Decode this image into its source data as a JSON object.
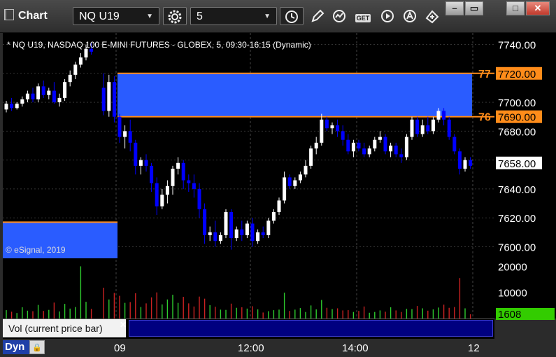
{
  "window": {
    "title": "Chart",
    "symbol": "NQ U19",
    "interval": "5",
    "controls": {
      "minimize": "–",
      "restore": "▭",
      "maximize": "□",
      "close": "✕"
    },
    "toolbar_icons": [
      "interval-clock-icon",
      "pencil-icon",
      "cursor-icon",
      "get-icon",
      "play-icon",
      "autoscale-icon",
      "link-icon"
    ]
  },
  "chart": {
    "header": "* NQ U19, NASDAQ 100 E-MINI FUTURES - GLOBEX, 5, 09:30-16:15 (Dynamic)",
    "copyright": "© eSignal, 2019",
    "price_ticks": [
      "7740.00",
      "7700.00",
      "7680.00",
      "7640.00",
      "7620.00",
      "7600.00"
    ],
    "levels": [
      {
        "short": "77",
        "price": "7720.00"
      },
      {
        "short": "76",
        "price": "7690.00"
      }
    ],
    "last_price": "7658.00",
    "vol_ticks": [
      "20000",
      "10000"
    ],
    "last_volume": "1608",
    "volume_study_label": "Vol (current price bar)",
    "time_ticks": [
      "09",
      "12:00",
      "14:00",
      "12"
    ],
    "bottom_buttons": {
      "dyn": "Dyn"
    },
    "colors": {
      "up": "#ffffff",
      "down": "#0000ff",
      "zone": "#2a5cff",
      "level_line": "#ff8c1a",
      "vol_up": "#2ecc2e",
      "vol_down": "#cc2222",
      "last_volume_bg": "#33cc00"
    }
  },
  "chart_data": {
    "type": "candlestick",
    "session_breaks": [
      "09:30"
    ],
    "price_ylim": [
      7592,
      7748
    ],
    "volume_ylim": [
      0,
      22000
    ],
    "candles": [
      {
        "o": 7695,
        "h": 7701,
        "c": 7699,
        "l": 7693
      },
      {
        "o": 7699,
        "h": 7703,
        "c": 7696,
        "l": 7694
      },
      {
        "o": 7696,
        "h": 7700,
        "c": 7699,
        "l": 7695
      },
      {
        "o": 7699,
        "h": 7704,
        "c": 7702,
        "l": 7697
      },
      {
        "o": 7702,
        "h": 7708,
        "c": 7706,
        "l": 7700
      },
      {
        "o": 7706,
        "h": 7710,
        "c": 7702,
        "l": 7700
      },
      {
        "o": 7702,
        "h": 7713,
        "c": 7711,
        "l": 7700
      },
      {
        "o": 7711,
        "h": 7715,
        "c": 7705,
        "l": 7703
      },
      {
        "o": 7705,
        "h": 7710,
        "c": 7708,
        "l": 7702
      },
      {
        "o": 7708,
        "h": 7714,
        "c": 7700,
        "l": 7699
      },
      {
        "o": 7700,
        "h": 7706,
        "c": 7703,
        "l": 7697
      },
      {
        "o": 7703,
        "h": 7716,
        "c": 7714,
        "l": 7701
      },
      {
        "o": 7714,
        "h": 7722,
        "c": 7719,
        "l": 7711
      },
      {
        "o": 7719,
        "h": 7728,
        "c": 7726,
        "l": 7716
      },
      {
        "o": 7726,
        "h": 7734,
        "c": 7731,
        "l": 7724
      },
      {
        "o": 7731,
        "h": 7740,
        "c": 7737,
        "l": 7729
      },
      {
        "o": 7737,
        "h": 7741,
        "c": 7735,
        "l": 7733
      },
      {
        "o": 7710,
        "h": 7720,
        "c": 7694,
        "l": 7691
      },
      {
        "o": 7694,
        "h": 7719,
        "c": 7714,
        "l": 7690
      },
      {
        "o": 7714,
        "h": 7718,
        "c": 7690,
        "l": 7686
      },
      {
        "o": 7690,
        "h": 7692,
        "c": 7676,
        "l": 7672
      },
      {
        "o": 7676,
        "h": 7684,
        "c": 7680,
        "l": 7668
      },
      {
        "o": 7680,
        "h": 7688,
        "c": 7672,
        "l": 7666
      },
      {
        "o": 7672,
        "h": 7674,
        "c": 7656,
        "l": 7650
      },
      {
        "o": 7656,
        "h": 7662,
        "c": 7660,
        "l": 7650
      },
      {
        "o": 7660,
        "h": 7664,
        "c": 7656,
        "l": 7652
      },
      {
        "o": 7656,
        "h": 7658,
        "c": 7644,
        "l": 7638
      },
      {
        "o": 7644,
        "h": 7648,
        "c": 7628,
        "l": 7622
      },
      {
        "o": 7628,
        "h": 7640,
        "c": 7636,
        "l": 7626
      },
      {
        "o": 7636,
        "h": 7646,
        "c": 7642,
        "l": 7630
      },
      {
        "o": 7642,
        "h": 7656,
        "c": 7654,
        "l": 7636
      },
      {
        "o": 7654,
        "h": 7662,
        "c": 7658,
        "l": 7650
      },
      {
        "o": 7658,
        "h": 7660,
        "c": 7646,
        "l": 7640
      },
      {
        "o": 7646,
        "h": 7650,
        "c": 7644,
        "l": 7638
      },
      {
        "o": 7644,
        "h": 7650,
        "c": 7640,
        "l": 7634
      },
      {
        "o": 7640,
        "h": 7644,
        "c": 7626,
        "l": 7620
      },
      {
        "o": 7626,
        "h": 7630,
        "c": 7608,
        "l": 7602
      },
      {
        "o": 7608,
        "h": 7614,
        "c": 7610,
        "l": 7604
      },
      {
        "o": 7610,
        "h": 7618,
        "c": 7604,
        "l": 7600
      },
      {
        "o": 7604,
        "h": 7610,
        "c": 7608,
        "l": 7602
      },
      {
        "o": 7608,
        "h": 7626,
        "c": 7624,
        "l": 7606
      },
      {
        "o": 7624,
        "h": 7626,
        "c": 7606,
        "l": 7598
      },
      {
        "o": 7606,
        "h": 7614,
        "c": 7612,
        "l": 7604
      },
      {
        "o": 7612,
        "h": 7618,
        "c": 7608,
        "l": 7604
      },
      {
        "o": 7608,
        "h": 7618,
        "c": 7616,
        "l": 7606
      },
      {
        "o": 7616,
        "h": 7620,
        "c": 7604,
        "l": 7600
      },
      {
        "o": 7604,
        "h": 7612,
        "c": 7610,
        "l": 7602
      },
      {
        "o": 7610,
        "h": 7614,
        "c": 7608,
        "l": 7606
      },
      {
        "o": 7608,
        "h": 7620,
        "c": 7618,
        "l": 7606
      },
      {
        "o": 7618,
        "h": 7626,
        "c": 7624,
        "l": 7616
      },
      {
        "o": 7624,
        "h": 7634,
        "c": 7632,
        "l": 7622
      },
      {
        "o": 7632,
        "h": 7652,
        "c": 7648,
        "l": 7630
      },
      {
        "o": 7648,
        "h": 7650,
        "c": 7642,
        "l": 7640
      },
      {
        "o": 7642,
        "h": 7648,
        "c": 7646,
        "l": 7640
      },
      {
        "o": 7646,
        "h": 7652,
        "c": 7650,
        "l": 7644
      },
      {
        "o": 7650,
        "h": 7660,
        "c": 7656,
        "l": 7648
      },
      {
        "o": 7656,
        "h": 7670,
        "c": 7668,
        "l": 7654
      },
      {
        "o": 7668,
        "h": 7676,
        "c": 7672,
        "l": 7664
      },
      {
        "o": 7672,
        "h": 7692,
        "c": 7688,
        "l": 7670
      },
      {
        "o": 7688,
        "h": 7690,
        "c": 7682,
        "l": 7680
      },
      {
        "o": 7682,
        "h": 7686,
        "c": 7684,
        "l": 7678
      },
      {
        "o": 7684,
        "h": 7688,
        "c": 7680,
        "l": 7676
      },
      {
        "o": 7680,
        "h": 7684,
        "c": 7674,
        "l": 7670
      },
      {
        "o": 7674,
        "h": 7678,
        "c": 7666,
        "l": 7664
      },
      {
        "o": 7666,
        "h": 7674,
        "c": 7672,
        "l": 7662
      },
      {
        "o": 7672,
        "h": 7674,
        "c": 7668,
        "l": 7666
      },
      {
        "o": 7668,
        "h": 7672,
        "c": 7664,
        "l": 7662
      },
      {
        "o": 7664,
        "h": 7670,
        "c": 7668,
        "l": 7662
      },
      {
        "o": 7668,
        "h": 7676,
        "c": 7674,
        "l": 7666
      },
      {
        "o": 7674,
        "h": 7680,
        "c": 7676,
        "l": 7672
      },
      {
        "o": 7676,
        "h": 7678,
        "c": 7666,
        "l": 7664
      },
      {
        "o": 7666,
        "h": 7672,
        "c": 7670,
        "l": 7662
      },
      {
        "o": 7670,
        "h": 7672,
        "c": 7664,
        "l": 7662
      },
      {
        "o": 7664,
        "h": 7668,
        "c": 7662,
        "l": 7658
      },
      {
        "o": 7662,
        "h": 7678,
        "c": 7676,
        "l": 7660
      },
      {
        "o": 7676,
        "h": 7690,
        "c": 7688,
        "l": 7674
      },
      {
        "o": 7688,
        "h": 7690,
        "c": 7678,
        "l": 7676
      },
      {
        "o": 7678,
        "h": 7688,
        "c": 7684,
        "l": 7676
      },
      {
        "o": 7684,
        "h": 7690,
        "c": 7680,
        "l": 7678
      },
      {
        "o": 7680,
        "h": 7690,
        "c": 7688,
        "l": 7678
      },
      {
        "o": 7688,
        "h": 7696,
        "c": 7694,
        "l": 7686
      },
      {
        "o": 7694,
        "h": 7696,
        "c": 7688,
        "l": 7684
      },
      {
        "o": 7688,
        "h": 7690,
        "c": 7676,
        "l": 7674
      },
      {
        "o": 7676,
        "h": 7678,
        "c": 7666,
        "l": 7664
      },
      {
        "o": 7666,
        "h": 7668,
        "c": 7654,
        "l": 7650
      },
      {
        "o": 7654,
        "h": 7662,
        "c": 7660,
        "l": 7652
      },
      {
        "o": 7660,
        "h": 7662,
        "c": 7656,
        "l": 7654
      }
    ],
    "volume": [
      3200,
      2600,
      2100,
      4300,
      3000,
      2800,
      5200,
      2900,
      3300,
      6100,
      2700,
      5600,
      3800,
      4400,
      20000,
      6400,
      3700,
      11800,
      7300,
      9800,
      8700,
      6000,
      6300,
      9700,
      4400,
      5800,
      8100,
      10000,
      5400,
      7300,
      9100,
      6000,
      8300,
      5800,
      4600,
      8400,
      7600,
      5100,
      4500,
      3400,
      3300,
      5700,
      4100,
      4300,
      3800,
      4700,
      3500,
      2300,
      2800,
      3200,
      3400,
      9900,
      2900,
      3400,
      4000,
      2500,
      5000,
      3500,
      7100,
      4100,
      3600,
      3900,
      3100,
      3200,
      2500,
      2900,
      4600,
      2200,
      2500,
      3100,
      2600,
      4300,
      3100,
      2500,
      3700,
      3600,
      4800,
      3900,
      3000,
      3500,
      4200,
      5300,
      4100,
      4400,
      15500,
      3900,
      1608
    ]
  }
}
